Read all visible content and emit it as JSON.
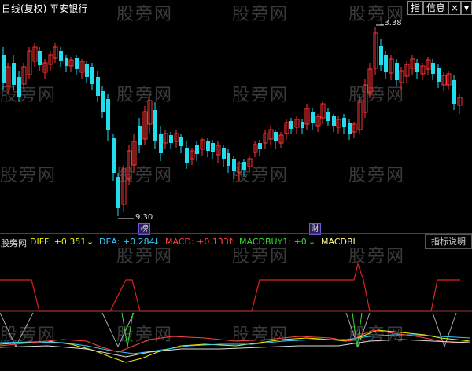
{
  "header": {
    "title": "日线(复权)  平安银行",
    "buttons": {
      "zhi": "指",
      "info": "信息",
      "close": "×",
      "dropdown": "▾"
    }
  },
  "watermark": "股旁网",
  "price_chart": {
    "high_label": "13.38",
    "low_label": "9.30",
    "badge_bang": "榜",
    "badge_cai": "财"
  },
  "indicator": {
    "source": "股旁网",
    "diff": {
      "label": "DIFF: +0.351",
      "arrow": "↓",
      "color": "#f0f000"
    },
    "dea": {
      "label": "DEA: +0.284",
      "arrow": "↓",
      "color": "#33ccff"
    },
    "macd": {
      "label": "MACD: +0.133",
      "arrow": "↑",
      "color": "#ff4444"
    },
    "macdbuy1": {
      "label": "MACDBUY1: +0",
      "arrow": "↓",
      "color": "#33dd33"
    },
    "macdbi": {
      "label": "MACDBI",
      "color": "#ffff88"
    },
    "explain_button": "指标说明"
  },
  "colors": {
    "up": "#ff3333",
    "down": "#22ddee",
    "background": "#000000"
  }
}
